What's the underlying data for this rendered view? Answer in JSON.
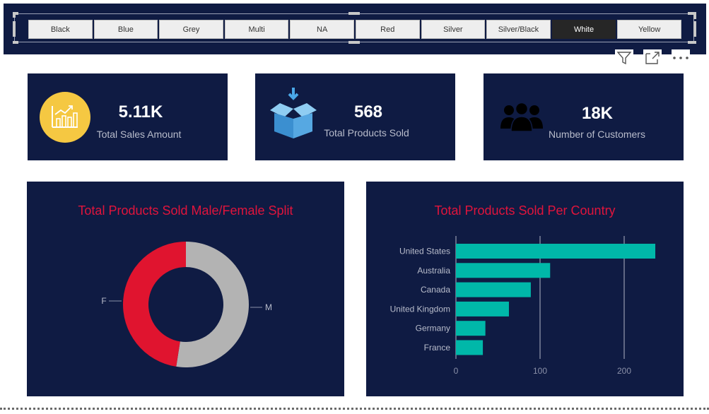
{
  "slicer": {
    "options": [
      "Black",
      "Blue",
      "Grey",
      "Multi",
      "NA",
      "Red",
      "Silver",
      "Silver/Black",
      "White",
      "Yellow"
    ],
    "selected": "White"
  },
  "header_icons": [
    "filter-icon",
    "focus-mode-icon",
    "more-options-icon"
  ],
  "kpis": [
    {
      "value": "5.11K",
      "label": "Total Sales Amount",
      "icon": "sales-chart-icon"
    },
    {
      "value": "568",
      "label": "Total Products Sold",
      "icon": "open-box-icon"
    },
    {
      "value": "18K",
      "label": "Number of Customers",
      "icon": "customers-icon"
    }
  ],
  "colors": {
    "panel": "#0f1b43",
    "title": "#e0143c",
    "female": "#e0142f",
    "male": "#b3b3b3",
    "bar": "#00b8a9"
  },
  "chart_data": [
    {
      "type": "pie",
      "donut": true,
      "title": "Total Products Sold Male/Female Split",
      "categories": [
        "F",
        "M"
      ],
      "values": [
        270,
        298
      ]
    },
    {
      "type": "bar",
      "orientation": "horizontal",
      "title": "Total Products Sold Per Country",
      "categories": [
        "United States",
        "Australia",
        "Canada",
        "United Kingdom",
        "Germany",
        "France"
      ],
      "values": [
        237,
        112,
        89,
        63,
        35,
        32
      ],
      "xlim": [
        0,
        240
      ],
      "xticks": [
        0,
        100,
        200
      ],
      "grid": true
    }
  ]
}
